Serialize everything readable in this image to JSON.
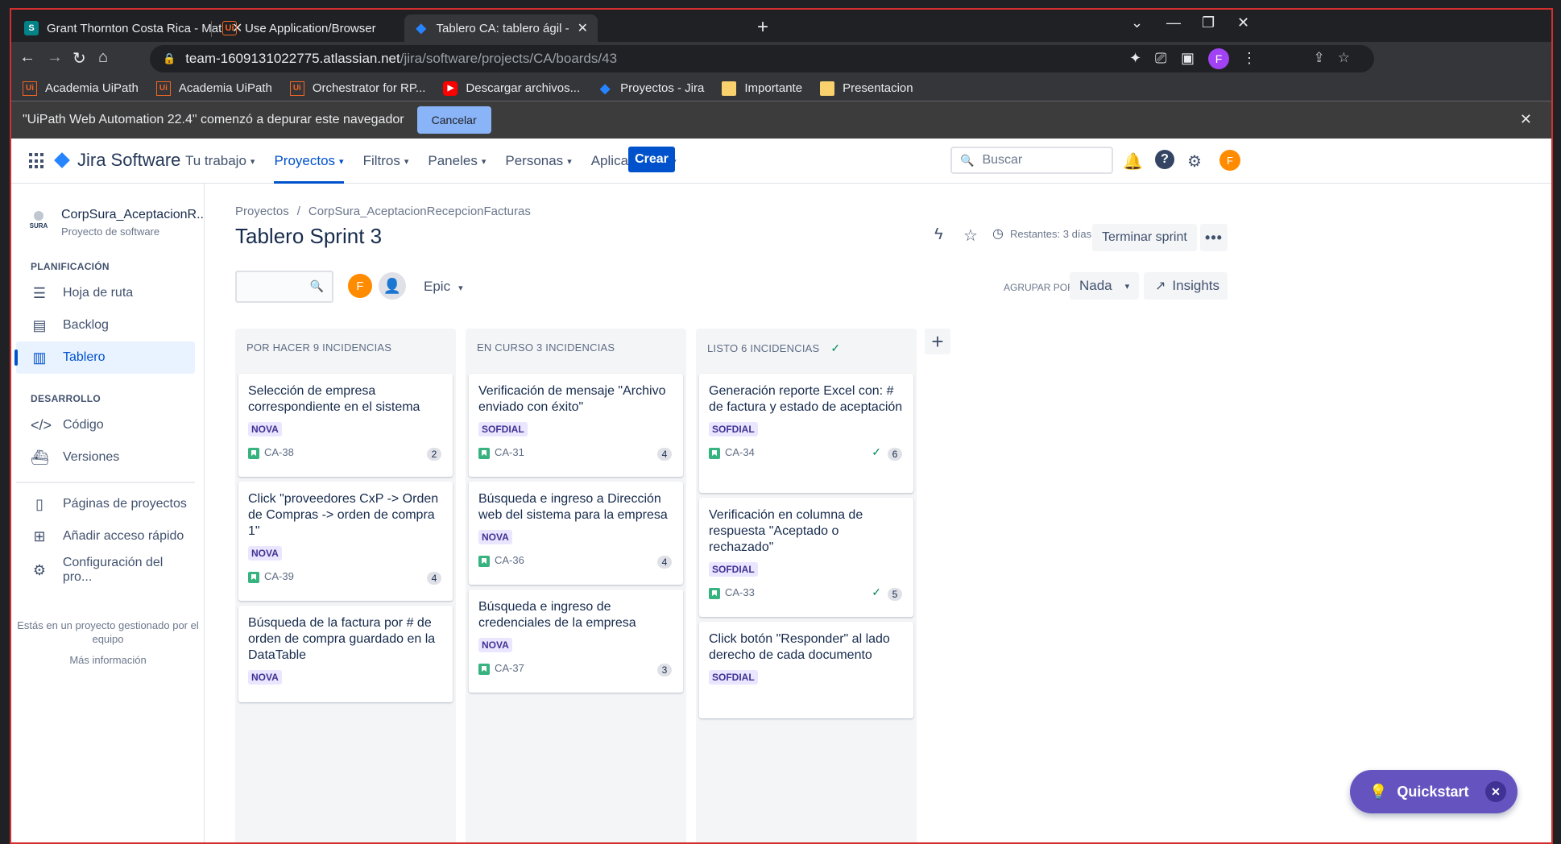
{
  "browser": {
    "tabs": [
      {
        "title": "Grant Thornton Costa Rica - Mat",
        "favicon": "sharepoint-icon"
      },
      {
        "title": "Use Application/Browser",
        "favicon": "uipath-icon"
      },
      {
        "title": "Tablero CA: tablero ágil - Jira",
        "favicon": "jira-icon"
      }
    ],
    "url_host": "team-1609131022775.atlassian.net",
    "url_path": "/jira/software/projects/CA/boards/43",
    "profile_initial": "F",
    "bookmarks": [
      {
        "label": "Academia UiPath",
        "icon": "uipath-icon"
      },
      {
        "label": "Academia UiPath",
        "icon": "uipath-icon"
      },
      {
        "label": "Orchestrator for RP...",
        "icon": "uipath-icon"
      },
      {
        "label": "Descargar archivos...",
        "icon": "youtube-icon"
      },
      {
        "label": "Proyectos - Jira",
        "icon": "jira-icon"
      },
      {
        "label": "Importante",
        "icon": "folder-icon"
      },
      {
        "label": "Presentacion",
        "icon": "folder-icon"
      }
    ],
    "infobar": {
      "message": "\"UiPath Web Automation 22.4\" comenzó a depurar este navegador",
      "cancel_label": "Cancelar"
    }
  },
  "jira": {
    "product": "Jira Software",
    "nav": [
      "Tu trabajo",
      "Proyectos",
      "Filtros",
      "Paneles",
      "Personas",
      "Aplicaciones"
    ],
    "create_label": "Crear",
    "search_placeholder": "Buscar",
    "user_initial": "F"
  },
  "sidebar": {
    "project_name": "CorpSura_AceptacionR...",
    "project_type": "Proyecto de software",
    "logo_text": "SURA",
    "planning_header": "PLANIFICACIÓN",
    "planning_items": [
      "Hoja de ruta",
      "Backlog",
      "Tablero"
    ],
    "dev_header": "DESARROLLO",
    "dev_items": [
      "Código",
      "Versiones"
    ],
    "other_items": [
      "Páginas de proyectos",
      "Añadir acceso rápido",
      "Configuración del pro..."
    ],
    "footer": "Estás en un proyecto gestionado por el equipo",
    "footer_link": "Más información"
  },
  "board": {
    "breadcrumb_root": "Proyectos",
    "breadcrumb_project": "CorpSura_AceptacionRecepcionFacturas",
    "title": "Tablero Sprint 3",
    "remaining": "Restantes: 3 días",
    "end_sprint": "Terminar sprint",
    "avatar_initial": "F",
    "epic_label": "Epic",
    "group_by_label": "AGRUPAR POR",
    "group_by_value": "Nada",
    "insights_label": "Insights",
    "columns": [
      {
        "header": "POR HACER 9 INCIDENCIAS",
        "cards": [
          {
            "text": "Selección de empresa correspondiente en el sistema",
            "tag": "NOVA",
            "key": "CA-38",
            "points": "2"
          },
          {
            "text": "Click \"proveedores CxP -> Orden de Compras -> orden de compra 1\"",
            "tag": "NOVA",
            "key": "CA-39",
            "points": "4"
          },
          {
            "text": "Búsqueda de la factura por # de orden de compra guardado en la DataTable",
            "tag": "NOVA",
            "key": "",
            "points": ""
          }
        ]
      },
      {
        "header": "EN CURSO 3 INCIDENCIAS",
        "cards": [
          {
            "text": "Verificación de mensaje \"Archivo enviado con éxito\"",
            "tag": "SOFDIAL",
            "key": "CA-31",
            "points": "4"
          },
          {
            "text": "Búsqueda e ingreso a Dirección web del sistema para la empresa",
            "tag": "NOVA",
            "key": "CA-36",
            "points": "4"
          },
          {
            "text": "Búsqueda e ingreso de credenciales de la empresa",
            "tag": "NOVA",
            "key": "CA-37",
            "points": "3"
          }
        ]
      },
      {
        "header": "LISTO 6 INCIDENCIAS",
        "cards": [
          {
            "text": "Generación reporte Excel con: # de factura y estado de aceptación",
            "tag": "SOFDIAL",
            "key": "CA-34",
            "points": "6"
          },
          {
            "text": "Verificación en columna de respuesta \"Aceptado o rechazado\"",
            "tag": "SOFDIAL",
            "key": "CA-33",
            "points": "5"
          },
          {
            "text": "Click botón \"Responder\" al lado derecho de cada documento",
            "tag": "SOFDIAL",
            "key": "",
            "points": ""
          }
        ]
      }
    ]
  },
  "quickstart": {
    "label": "Quickstart"
  }
}
